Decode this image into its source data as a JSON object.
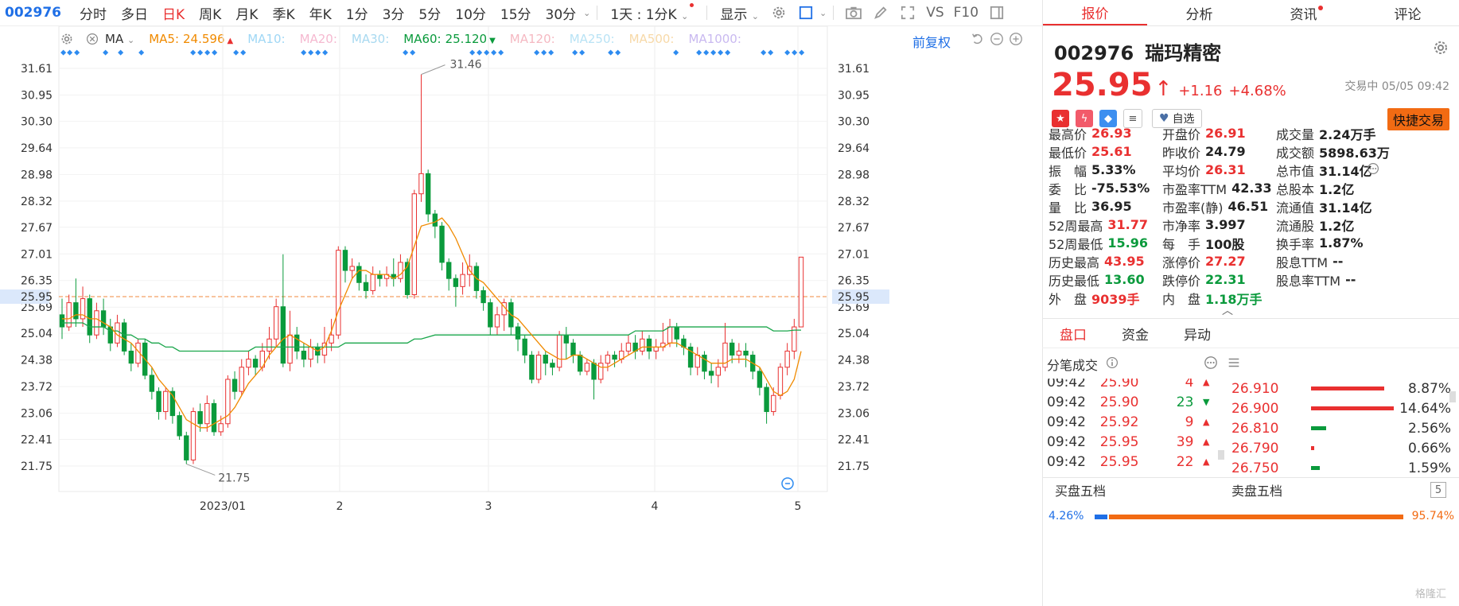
{
  "toolbar": {
    "code": "002976",
    "periods": [
      "分时",
      "多日",
      "日K",
      "周K",
      "月K",
      "季K",
      "年K",
      "1分",
      "3分",
      "5分",
      "10分",
      "15分",
      "30分"
    ],
    "active_period": "日K",
    "interval_label": "1天 : 1分K",
    "display_label": "显示",
    "vs_label": "VS",
    "f10_label": "F10"
  },
  "ma_legend": {
    "type_label": "MA",
    "items": [
      {
        "name": "MA5:",
        "value": "24.596",
        "color": "#f08a00",
        "arrow": "▲",
        "arrow_color": "#e93030"
      },
      {
        "name": "MA10:",
        "value": "",
        "color": "#9fd7f5"
      },
      {
        "name": "MA20:",
        "value": "",
        "color": "#f5b9d0"
      },
      {
        "name": "MA30:",
        "value": "",
        "color": "#a8d9f0"
      },
      {
        "name": "MA60:",
        "value": "25.120",
        "color": "#0a9a3c",
        "arrow": "▼",
        "arrow_color": "#0a9a3c"
      },
      {
        "name": "MA120:",
        "value": "",
        "color": "#f5b9c2"
      },
      {
        "name": "MA250:",
        "value": "",
        "color": "#b9e3f5"
      },
      {
        "name": "MA500:",
        "value": "",
        "color": "#f7d9a8"
      },
      {
        "name": "MA1000:",
        "value": "",
        "color": "#c9b9f0"
      }
    ],
    "fuquan_label": "前复权"
  },
  "chart_data": {
    "type": "candlestick",
    "y_ticks": [
      "31.61",
      "30.95",
      "30.30",
      "29.64",
      "28.98",
      "28.32",
      "27.67",
      "27.01",
      "26.35",
      "25.95",
      "25.69",
      "25.04",
      "24.38",
      "23.72",
      "23.06",
      "22.41",
      "21.75"
    ],
    "ylim": [
      21.75,
      31.61
    ],
    "current_price_label": "25.95",
    "x_labels": [
      "2023/01",
      "2",
      "3",
      "4",
      "5"
    ],
    "annotations": [
      {
        "text": "31.46"
      },
      {
        "text": "21.75"
      }
    ],
    "candles": [
      [
        25.5,
        25.2,
        25.9,
        24.9
      ],
      [
        25.2,
        25.8,
        26.0,
        25.1
      ],
      [
        25.8,
        25.4,
        26.4,
        25.2
      ],
      [
        25.4,
        25.9,
        26.2,
        25.2
      ],
      [
        25.9,
        25.0,
        26.0,
        24.8
      ],
      [
        25.0,
        25.6,
        25.8,
        24.9
      ],
      [
        25.6,
        25.2,
        25.9,
        25.0
      ],
      [
        25.2,
        24.8,
        25.4,
        24.6
      ],
      [
        24.8,
        25.3,
        25.5,
        24.7
      ],
      [
        25.3,
        24.6,
        25.4,
        24.5
      ],
      [
        24.6,
        24.3,
        24.8,
        24.1
      ],
      [
        24.3,
        24.8,
        24.9,
        24.2
      ],
      [
        24.8,
        24.0,
        24.9,
        23.9
      ],
      [
        24.0,
        23.6,
        24.2,
        23.4
      ],
      [
        23.6,
        23.1,
        23.7,
        22.9
      ],
      [
        23.1,
        23.6,
        23.7,
        22.9
      ],
      [
        23.6,
        23.0,
        23.7,
        22.8
      ],
      [
        23.0,
        22.5,
        23.1,
        22.4
      ],
      [
        22.5,
        21.9,
        22.6,
        21.8
      ],
      [
        21.9,
        23.1,
        23.2,
        21.8
      ],
      [
        23.1,
        22.8,
        23.3,
        22.6
      ],
      [
        22.8,
        23.3,
        23.5,
        22.6
      ],
      [
        23.3,
        22.6,
        23.4,
        22.5
      ],
      [
        22.6,
        22.8,
        23.0,
        22.5
      ],
      [
        22.8,
        23.9,
        24.0,
        22.7
      ],
      [
        23.9,
        23.6,
        24.1,
        23.4
      ],
      [
        23.6,
        24.2,
        24.4,
        23.5
      ],
      [
        24.2,
        24.4,
        24.6,
        24.0
      ],
      [
        24.4,
        24.2,
        24.5,
        24.0
      ],
      [
        24.2,
        24.6,
        24.8,
        24.1
      ],
      [
        24.6,
        24.9,
        25.2,
        24.4
      ],
      [
        24.9,
        25.7,
        25.9,
        24.7
      ],
      [
        25.7,
        24.3,
        27.0,
        24.2
      ],
      [
        24.3,
        25.0,
        25.6,
        24.1
      ],
      [
        25.0,
        24.6,
        25.2,
        24.4
      ],
      [
        24.6,
        24.4,
        24.8,
        24.2
      ],
      [
        24.4,
        24.7,
        24.9,
        24.2
      ],
      [
        24.7,
        24.5,
        24.8,
        24.3
      ],
      [
        24.5,
        24.8,
        25.2,
        24.3
      ],
      [
        24.8,
        25.0,
        25.4,
        24.6
      ],
      [
        25.0,
        27.1,
        27.2,
        24.9
      ],
      [
        27.1,
        26.6,
        27.2,
        26.3
      ],
      [
        26.6,
        26.7,
        26.9,
        26.4
      ],
      [
        26.7,
        26.3,
        26.8,
        26.1
      ],
      [
        26.3,
        26.1,
        26.5,
        25.9
      ],
      [
        26.1,
        26.5,
        26.7,
        26.0
      ],
      [
        26.5,
        26.4,
        26.6,
        26.2
      ],
      [
        26.4,
        26.5,
        26.7,
        26.2
      ],
      [
        26.5,
        26.4,
        26.9,
        26.2
      ],
      [
        26.4,
        26.8,
        27.0,
        26.3
      ],
      [
        26.8,
        26.0,
        26.9,
        25.9
      ],
      [
        26.0,
        28.5,
        28.6,
        25.9
      ],
      [
        28.5,
        29.0,
        31.46,
        28.3
      ],
      [
        29.0,
        28.0,
        29.1,
        27.8
      ],
      [
        28.0,
        27.7,
        28.1,
        27.4
      ],
      [
        27.7,
        26.8,
        27.8,
        26.6
      ],
      [
        26.8,
        26.4,
        26.9,
        26.1
      ],
      [
        26.4,
        26.2,
        26.5,
        25.7
      ],
      [
        26.2,
        26.5,
        26.8,
        26.0
      ],
      [
        26.5,
        26.7,
        27.0,
        26.2
      ],
      [
        26.7,
        26.1,
        26.8,
        25.9
      ],
      [
        26.1,
        25.8,
        26.2,
        25.6
      ],
      [
        25.8,
        25.2,
        25.9,
        25.0
      ],
      [
        25.2,
        25.5,
        25.7,
        25.0
      ],
      [
        25.5,
        25.8,
        25.9,
        25.1
      ],
      [
        25.8,
        25.2,
        25.9,
        25.0
      ],
      [
        25.2,
        24.9,
        25.3,
        24.6
      ],
      [
        24.9,
        24.5,
        25.0,
        24.3
      ],
      [
        24.5,
        23.9,
        24.6,
        23.8
      ],
      [
        23.9,
        24.5,
        24.6,
        23.8
      ],
      [
        24.5,
        24.3,
        24.6,
        24.0
      ],
      [
        24.3,
        24.2,
        24.4,
        24.0
      ],
      [
        24.2,
        25.0,
        25.1,
        24.1
      ],
      [
        25.0,
        24.8,
        25.2,
        24.4
      ],
      [
        24.8,
        24.5,
        24.9,
        24.3
      ],
      [
        24.5,
        24.1,
        24.6,
        24.0
      ],
      [
        24.1,
        24.3,
        24.4,
        24.0
      ],
      [
        24.3,
        23.9,
        24.4,
        23.4
      ],
      [
        23.9,
        24.3,
        24.5,
        23.8
      ],
      [
        24.3,
        24.5,
        24.6,
        24.1
      ],
      [
        24.5,
        24.4,
        24.6,
        24.2
      ],
      [
        24.4,
        24.6,
        24.8,
        24.3
      ],
      [
        24.6,
        24.8,
        25.0,
        24.5
      ],
      [
        24.8,
        24.6,
        25.0,
        24.4
      ],
      [
        24.6,
        24.9,
        25.1,
        24.5
      ],
      [
        24.9,
        24.6,
        25.0,
        24.4
      ],
      [
        24.6,
        24.7,
        24.9,
        24.4
      ],
      [
        24.7,
        24.8,
        25.3,
        24.6
      ],
      [
        24.8,
        25.2,
        25.4,
        24.7
      ],
      [
        25.2,
        24.9,
        25.3,
        24.7
      ],
      [
        24.9,
        24.7,
        25.0,
        24.5
      ],
      [
        24.7,
        24.2,
        24.8,
        24.0
      ],
      [
        24.2,
        24.5,
        24.7,
        24.0
      ],
      [
        24.5,
        24.1,
        24.6,
        23.9
      ],
      [
        24.1,
        24.0,
        24.3,
        23.8
      ],
      [
        24.0,
        24.2,
        24.4,
        23.7
      ],
      [
        24.2,
        24.8,
        25.3,
        24.1
      ],
      [
        24.8,
        24.5,
        24.9,
        24.3
      ],
      [
        24.5,
        24.6,
        24.8,
        24.3
      ],
      [
        24.6,
        24.5,
        24.8,
        24.2
      ],
      [
        24.5,
        24.1,
        24.6,
        23.9
      ],
      [
        24.1,
        23.7,
        24.2,
        23.5
      ],
      [
        23.7,
        23.1,
        23.8,
        22.8
      ],
      [
        23.1,
        23.5,
        23.7,
        23.0
      ],
      [
        23.5,
        24.2,
        24.3,
        23.4
      ],
      [
        24.2,
        24.6,
        24.8,
        24.0
      ],
      [
        24.6,
        25.2,
        25.4,
        24.4
      ],
      [
        25.2,
        26.93,
        26.93,
        25.61
      ]
    ],
    "ma5": [
      25.4,
      25.4,
      25.5,
      25.5,
      25.4,
      25.4,
      25.3,
      25.2,
      25.0,
      24.9,
      24.8,
      24.6,
      24.4,
      24.2,
      23.9,
      23.7,
      23.5,
      23.2,
      22.9,
      22.8,
      22.7,
      22.7,
      22.8,
      22.9,
      23.0,
      23.2,
      23.5,
      23.8,
      24.0,
      24.2,
      24.5,
      24.7,
      24.9,
      25.0,
      24.9,
      24.8,
      24.7,
      24.6,
      24.7,
      25.1,
      25.6,
      26.0,
      26.4,
      26.6,
      26.6,
      26.5,
      26.5,
      26.5,
      26.4,
      26.5,
      26.7,
      27.2,
      27.7,
      27.8,
      27.9,
      27.7,
      27.4,
      27.0,
      26.6,
      26.4,
      26.3,
      26.1,
      25.9,
      25.7,
      25.5,
      25.4,
      25.2,
      25.0,
      24.8,
      24.6,
      24.5,
      24.4,
      24.4,
      24.5,
      24.5,
      24.4,
      24.3,
      24.2,
      24.2,
      24.3,
      24.4,
      24.5,
      24.6,
      24.7,
      24.7,
      24.7,
      24.7,
      24.8,
      24.8,
      24.7,
      24.6,
      24.5,
      24.4,
      24.3,
      24.3,
      24.3,
      24.4,
      24.4,
      24.4,
      24.3,
      24.2,
      23.9,
      23.6,
      23.5,
      23.6,
      23.9,
      24.596
    ],
    "ma60": [
      25.3,
      25.3,
      25.3,
      25.3,
      25.2,
      25.2,
      25.2,
      25.1,
      25.1,
      25.0,
      25.0,
      24.9,
      24.9,
      24.8,
      24.8,
      24.7,
      24.7,
      24.6,
      24.6,
      24.6,
      24.6,
      24.6,
      24.6,
      24.6,
      24.6,
      24.6,
      24.6,
      24.6,
      24.7,
      24.7,
      24.7,
      24.7,
      24.7,
      24.7,
      24.7,
      24.7,
      24.7,
      24.7,
      24.7,
      24.7,
      24.7,
      24.8,
      24.8,
      24.8,
      24.8,
      24.8,
      24.8,
      24.8,
      24.8,
      24.8,
      24.8,
      24.9,
      24.9,
      25.0,
      25.0,
      25.0,
      25.0,
      25.0,
      25.0,
      25.0,
      25.0,
      25.0,
      25.0,
      25.0,
      25.0,
      25.0,
      25.0,
      25.0,
      25.0,
      25.0,
      25.0,
      25.0,
      25.0,
      25.0,
      25.0,
      25.0,
      25.0,
      25.0,
      25.0,
      25.0,
      25.0,
      25.0,
      25.1,
      25.1,
      25.1,
      25.1,
      25.1,
      25.2,
      25.2,
      25.2,
      25.2,
      25.2,
      25.2,
      25.2,
      25.2,
      25.2,
      25.2,
      25.2,
      25.2,
      25.2,
      25.2,
      25.2,
      25.1,
      25.1,
      25.1,
      25.12,
      25.12
    ]
  },
  "right_panel": {
    "tabs": [
      "报价",
      "分析",
      "资讯",
      "评论"
    ],
    "active_tab": "报价",
    "code": "002976",
    "name": "瑞玛精密",
    "price": "25.95",
    "arrow": "↑",
    "change": "+1.16",
    "pct": "+4.68%",
    "status": "交易中 05/05 09:42",
    "watch_label": "自选",
    "quick_trade_label": "快捷交易",
    "quotes": [
      [
        {
          "l": "最高价",
          "v": "26.93",
          "c": "red"
        },
        {
          "l": "开盘价",
          "v": "26.91",
          "c": "red"
        },
        {
          "l": "成交量",
          "v": "2.24万手",
          "c": "dark"
        }
      ],
      [
        {
          "l": "最低价",
          "v": "25.61",
          "c": "red"
        },
        {
          "l": "昨收价",
          "v": "24.79",
          "c": "dark"
        },
        {
          "l": "成交额",
          "v": "5898.63万",
          "c": "dark"
        }
      ],
      [
        {
          "l": "振　幅",
          "v": "5.33%",
          "c": "dark"
        },
        {
          "l": "平均价",
          "v": "26.31",
          "c": "red"
        },
        {
          "l": "总市值",
          "v": "31.14亿",
          "c": "dark"
        }
      ],
      [
        {
          "l": "委　比",
          "v": "-75.53%",
          "c": "dark"
        },
        {
          "l": "市盈率TTM",
          "v": "42.33",
          "c": "dark"
        },
        {
          "l": "总股本",
          "v": "1.2亿",
          "c": "dark"
        }
      ],
      [
        {
          "l": "量　比",
          "v": "36.95",
          "c": "dark"
        },
        {
          "l": "市盈率(静)",
          "v": "46.51",
          "c": "dark"
        },
        {
          "l": "流通值",
          "v": "31.14亿",
          "c": "dark"
        }
      ],
      [
        {
          "l": "52周最高",
          "v": "31.77",
          "c": "red"
        },
        {
          "l": "市净率",
          "v": "3.997",
          "c": "dark"
        },
        {
          "l": "流通股",
          "v": "1.2亿",
          "c": "dark"
        }
      ],
      [
        {
          "l": "52周最低",
          "v": "15.96",
          "c": "green"
        },
        {
          "l": "每　手",
          "v": "100股",
          "c": "dark"
        },
        {
          "l": "换手率",
          "v": "1.87%",
          "c": "dark"
        }
      ],
      [
        {
          "l": "历史最高",
          "v": "43.95",
          "c": "red"
        },
        {
          "l": "涨停价",
          "v": "27.27",
          "c": "red"
        },
        {
          "l": "股息TTM",
          "v": "--",
          "c": "dark"
        }
      ],
      [
        {
          "l": "历史最低",
          "v": "13.60",
          "c": "green"
        },
        {
          "l": "跌停价",
          "v": "22.31",
          "c": "green"
        },
        {
          "l": "股息率TTM",
          "v": "--",
          "c": "dark"
        }
      ],
      [
        {
          "l": "外　盘",
          "v": "9039手",
          "c": "red"
        },
        {
          "l": "内　盘",
          "v": "1.18万手",
          "c": "green"
        }
      ]
    ],
    "sub_tabs": [
      "盘口",
      "资金",
      "异动"
    ],
    "active_sub_tab": "盘口",
    "ticks_title": "分笔成交",
    "ticks": [
      {
        "time": "09:42",
        "price": "25.90",
        "vol": "4",
        "dir": "up"
      },
      {
        "time": "09:42",
        "price": "25.90",
        "vol": "23",
        "dir": "down"
      },
      {
        "time": "09:42",
        "price": "25.92",
        "vol": "9",
        "dir": "up"
      },
      {
        "time": "09:42",
        "price": "25.95",
        "vol": "39",
        "dir": "up"
      },
      {
        "time": "09:42",
        "price": "25.95",
        "vol": "22",
        "dir": "up"
      }
    ],
    "dist": [
      {
        "price": "26.910",
        "pct": "8.87%",
        "bar": 0.88,
        "c": "red"
      },
      {
        "price": "26.900",
        "pct": "14.64%",
        "bar": 1.0,
        "c": "red"
      },
      {
        "price": "26.810",
        "pct": "2.56%",
        "bar": 0.18,
        "c": "green"
      },
      {
        "price": "26.790",
        "pct": "0.66%",
        "bar": 0.04,
        "c": "red"
      },
      {
        "price": "26.750",
        "pct": "1.59%",
        "bar": 0.11,
        "c": "green"
      }
    ],
    "book_buy_label": "买盘五档",
    "book_sell_label": "卖盘五档",
    "book_count": "5",
    "buy_pct": "4.26%",
    "sell_pct": "95.74%",
    "watermark": "格隆汇"
  }
}
